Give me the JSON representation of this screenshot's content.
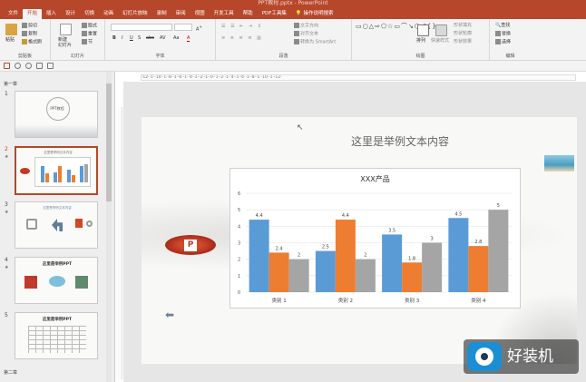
{
  "window": {
    "title": "PPT教程.pptx - PowerPoint"
  },
  "tabs": [
    "文件",
    "开始",
    "插入",
    "设计",
    "切换",
    "动画",
    "幻灯片放映",
    "录制",
    "审阅",
    "视图",
    "开发工具",
    "帮助",
    "PDF工具集",
    "操作说明搜索"
  ],
  "ribbon": {
    "clipboard": {
      "label": "剪贴板",
      "paste": "粘贴",
      "cut": "剪切",
      "copy": "复制",
      "format": "格式刷"
    },
    "slides": {
      "label": "幻灯片",
      "new_slide": "新建\n幻灯片",
      "layout": "版式",
      "reset": "重置",
      "section": "节"
    },
    "font": {
      "label": "字体",
      "bold": "B",
      "italic": "I",
      "underline": "U",
      "strike": "S",
      "abc": "abc",
      "shadow": "AV",
      "case": "Aa",
      "color": "A"
    },
    "paragraph": {
      "label": "段落",
      "text_dir": "文字方向",
      "align_text": "对齐文本",
      "smartart": "转换为 SmartArt"
    },
    "drawing": {
      "label": "绘图",
      "arrange": "排列",
      "quick_styles": "快速样式",
      "fill": "形状填充",
      "outline": "形状轮廓",
      "effects": "形状效果"
    },
    "editing": {
      "label": "编辑",
      "find": "查找",
      "replace": "替换",
      "select": "选择"
    }
  },
  "sections": [
    "第一章",
    "第二章"
  ],
  "thumbnails": [
    {
      "num": "1",
      "title": "PPT教程"
    },
    {
      "num": "2",
      "title": "这里是举例文本内容"
    },
    {
      "num": "3",
      "title": "这里是举例文本内容"
    },
    {
      "num": "4",
      "title": "这里是举例PPT"
    },
    {
      "num": "5",
      "title": "这里是举例PPT"
    }
  ],
  "ruler": "·12··1··10··1··8··1··6··1··4··1··2··1··0··1··2··1··4··1··6··1··8··1··10··1··12·",
  "slide": {
    "title": "这里是举例文本内容",
    "ppt_logo": "P"
  },
  "watermark": "好装机",
  "colors": {
    "accent": "#b7472a",
    "s1": "#5b9bd5",
    "s2": "#ed7d31",
    "s3": "#a5a5a5"
  },
  "chart_data": {
    "type": "bar",
    "title": "XXX产品",
    "categories": [
      "类别 1",
      "类别 2",
      "类别 3",
      "类别 4"
    ],
    "series": [
      {
        "values": [
          4.4,
          2.5,
          3.5,
          4.5
        ]
      },
      {
        "values": [
          2.4,
          4.4,
          1.8,
          2.8
        ]
      },
      {
        "values": [
          2,
          2,
          3,
          5
        ]
      }
    ],
    "ylim": [
      0,
      6
    ],
    "yticks": [
      0,
      1,
      2,
      3,
      4,
      5,
      6
    ],
    "grid": true
  }
}
